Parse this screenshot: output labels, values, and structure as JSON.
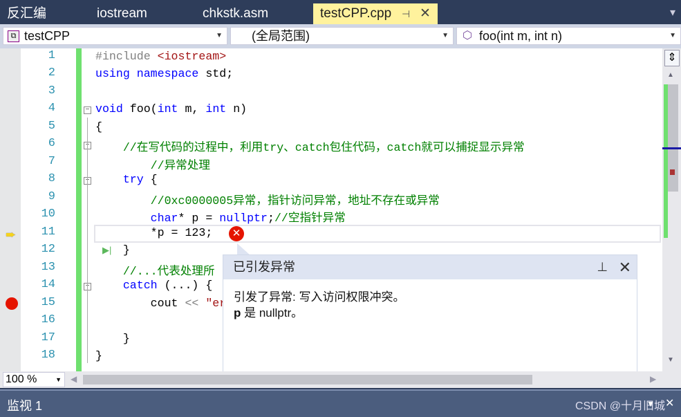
{
  "tabs": [
    {
      "label": "反汇编"
    },
    {
      "label": "iostream"
    },
    {
      "label": "chkstk.asm"
    },
    {
      "label": "testCPP.cpp",
      "active": true
    }
  ],
  "tab_pin_icon": "pin-icon",
  "tab_close": "✕",
  "tab_overflow": "▾",
  "nav": {
    "project": "testCPP",
    "scope": "(全局范围)",
    "member": "foo(int m, int n)"
  },
  "code": [
    {
      "n": "1",
      "tokens": [
        [
          "#include ",
          "p"
        ],
        [
          "<iostream>",
          "s"
        ]
      ]
    },
    {
      "n": "2",
      "tokens": [
        [
          "using namespace ",
          "k"
        ],
        [
          "std;",
          "o"
        ]
      ]
    },
    {
      "n": "3",
      "tokens": []
    },
    {
      "n": "4",
      "tokens": [
        [
          "void ",
          "k"
        ],
        [
          "foo(",
          "o"
        ],
        [
          "int ",
          "k"
        ],
        [
          "m, ",
          "o"
        ],
        [
          "int ",
          "k"
        ],
        [
          "n)",
          "o"
        ]
      ]
    },
    {
      "n": "5",
      "tokens": [
        [
          "{",
          "o"
        ]
      ]
    },
    {
      "n": "6",
      "tokens": [
        [
          "    //在写代码的过程中，利用try、catch包住代码，catch就可以捕捉显示异常",
          "c"
        ]
      ]
    },
    {
      "n": "7",
      "tokens": [
        [
          "        //异常处理",
          "c"
        ]
      ]
    },
    {
      "n": "8",
      "tokens": [
        [
          "    try ",
          "k"
        ],
        [
          "{",
          "o"
        ]
      ]
    },
    {
      "n": "9",
      "tokens": [
        [
          "        //0xc0000005异常，指针访问异常，地址不存在或异常",
          "c"
        ]
      ]
    },
    {
      "n": "10",
      "tokens": [
        [
          "        char",
          "k"
        ],
        [
          "* p = ",
          "o"
        ],
        [
          "nullptr",
          "k"
        ],
        [
          ";",
          "o"
        ],
        [
          "//空指针异常",
          "c"
        ]
      ]
    },
    {
      "n": "11",
      "tokens": [
        [
          "        *p = 123;",
          "o"
        ]
      ]
    },
    {
      "n": "12",
      "tokens": [
        [
          "    }",
          "o"
        ]
      ]
    },
    {
      "n": "13",
      "tokens": [
        [
          "    //...代表处理所",
          "c"
        ]
      ]
    },
    {
      "n": "14",
      "tokens": [
        [
          "    catch ",
          "k"
        ],
        [
          "(...) {",
          "o"
        ]
      ]
    },
    {
      "n": "15",
      "tokens": [
        [
          "        cout ",
          "o"
        ],
        [
          "<< ",
          "p"
        ],
        [
          "\"er",
          "s"
        ]
      ]
    },
    {
      "n": "16",
      "tokens": []
    },
    {
      "n": "17",
      "tokens": [
        [
          "    }",
          "o"
        ]
      ]
    },
    {
      "n": "18",
      "tokens": [
        [
          "}",
          "o"
        ]
      ]
    }
  ],
  "exception": {
    "title": "已引发异常",
    "message": "引发了异常: 写入访问权限冲突。",
    "var": "p",
    "detail": " 是 nullptr。"
  },
  "zoom": "100 %",
  "watch": {
    "title": "监视 1"
  },
  "watermark": "CSDN @十月旧城",
  "colors": {
    "breakpoint": "#e51400",
    "current_line_arrow": "#f5d31e",
    "changes_bar": "#6fe06f",
    "error": "#e51400"
  }
}
